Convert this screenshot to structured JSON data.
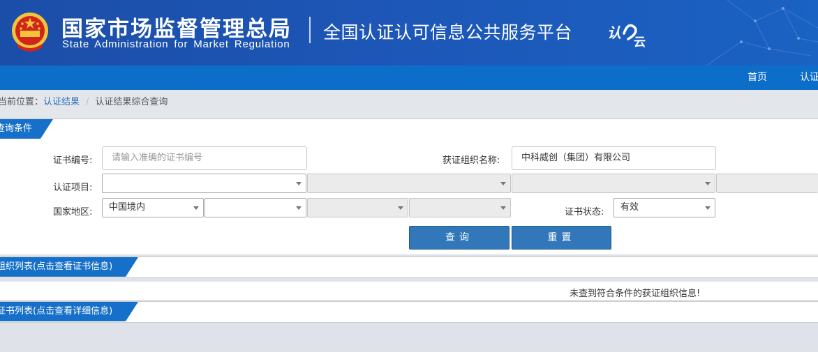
{
  "header": {
    "title_cn": "国家市场监督管理总局",
    "title_en": "State Administration  for  Market Regulation",
    "platform_title": "全国认证认可信息公共服务平台",
    "logo_text": "认云",
    "emblem_icon": "national-emblem-icon"
  },
  "nav": {
    "items": [
      {
        "label": "首页"
      },
      {
        "label": "认证"
      }
    ]
  },
  "breadcrumb": {
    "prefix": "当前位置：",
    "link": "认证结果",
    "sep": "/",
    "current": "认证结果综合查询"
  },
  "query": {
    "section_title": "查询条件",
    "cert_no_label": "证书编号:",
    "cert_no_placeholder": "请输入准确的证书编号",
    "org_name_label": "获证组织名称:",
    "org_name_value": "中科威创（集团）有限公司",
    "project_label": "认证项目:",
    "project_selects": [
      {
        "value": ""
      },
      {
        "value": ""
      },
      {
        "value": ""
      },
      {
        "value": ""
      }
    ],
    "region_label": "国家地区:",
    "region_selects": [
      {
        "value": "中国境内"
      },
      {
        "value": ""
      },
      {
        "value": ""
      },
      {
        "value": ""
      }
    ],
    "status_label": "证书状态:",
    "status_value": "有效",
    "search_button": "查询",
    "reset_button": "重置"
  },
  "org_list": {
    "section_title": "组织列表(点击查看证书信息)",
    "empty_message": "未查到符合条件的获证组织信息!"
  },
  "cert_list": {
    "section_title": "证书列表(点击查看详细信息)"
  },
  "colors": {
    "banner": "#1d56b6",
    "navbar": "#0d6ec9",
    "section_tab": "#1670c9",
    "button": "#3277b9"
  }
}
